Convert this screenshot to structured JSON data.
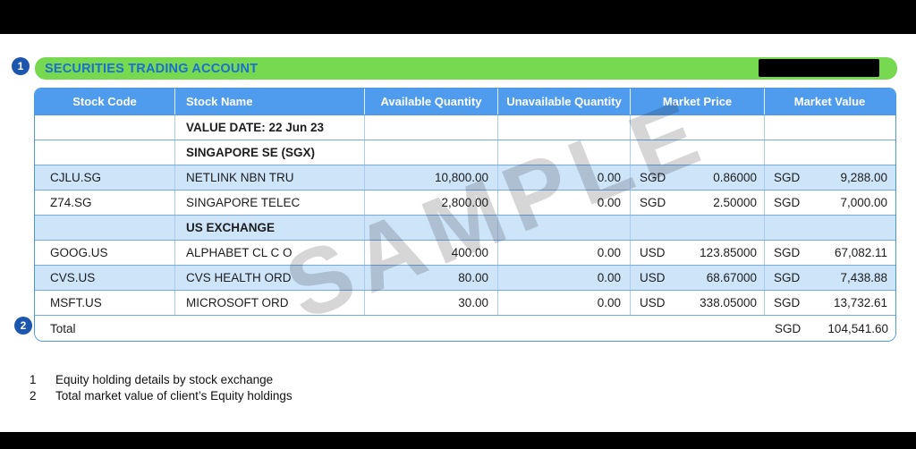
{
  "banner": {
    "marker": "1",
    "title": "SECURITIES TRADING ACCOUNT"
  },
  "watermark": {
    "text": "SAMPLE"
  },
  "table": {
    "headers": [
      "Stock Code",
      "Stock Name",
      "Available Quantity",
      "Unavailable Quantity",
      "Market Price",
      "Market Value"
    ],
    "rows": [
      {
        "stock_name": "VALUE DATE: 22 Jun 23"
      },
      {
        "stock_name": "SINGAPORE SE (SGX)"
      },
      {
        "stock_code": "CJLU.SG",
        "stock_name": "NETLINK NBN TRU",
        "available_qty": "10,800.00",
        "unavailable_qty": "0.00",
        "price_currency": "SGD",
        "market_price": "0.86000",
        "value_currency": "SGD",
        "market_value": "9,288.00"
      },
      {
        "stock_code": "Z74.SG",
        "stock_name": "SINGAPORE TELEC",
        "available_qty": "2,800.00",
        "unavailable_qty": "0.00",
        "price_currency": "SGD",
        "market_price": "2.50000",
        "value_currency": "SGD",
        "market_value": "7,000.00"
      },
      {
        "stock_name": "US EXCHANGE"
      },
      {
        "stock_code": "GOOG.US",
        "stock_name": "ALPHABET CL C O",
        "available_qty": "400.00",
        "unavailable_qty": "0.00",
        "price_currency": "USD",
        "market_price": "123.85000",
        "value_currency": "SGD",
        "market_value": "67,082.11"
      },
      {
        "stock_code": "CVS.US",
        "stock_name": "CVS HEALTH ORD",
        "available_qty": "80.00",
        "unavailable_qty": "0.00",
        "price_currency": "USD",
        "market_price": "68.67000",
        "value_currency": "SGD",
        "market_value": "7,438.88"
      },
      {
        "stock_code": "MSFT.US",
        "stock_name": "MICROSOFT ORD",
        "available_qty": "30.00",
        "unavailable_qty": "0.00",
        "price_currency": "USD",
        "market_price": "338.05000",
        "value_currency": "SGD",
        "market_value": "13,732.61"
      }
    ],
    "total": {
      "marker": "2",
      "label": "Total",
      "currency": "SGD",
      "amount": "104,541.60"
    }
  },
  "footnotes": [
    {
      "number": "1",
      "text": "Equity holding details by stock exchange"
    },
    {
      "number": "2",
      "text": "Total market value of client’s Equity holdings"
    }
  ],
  "colors": {
    "accent_green": "#76D94F",
    "banner_text_blue": "#1B6FD0",
    "header_blue": "#4F9BEE",
    "marker_blue": "#1C56AD",
    "row_shade_blue": "#CEE4F8",
    "table_border_blue": "#4D97E2"
  }
}
